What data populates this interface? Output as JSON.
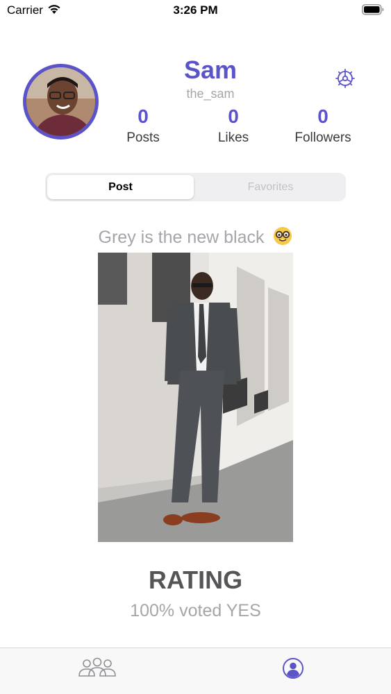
{
  "status_bar": {
    "carrier": "Carrier",
    "time": "3:26 PM"
  },
  "profile": {
    "name": "Sam",
    "handle": "the_sam",
    "stats": [
      {
        "value": "0",
        "label": "Posts"
      },
      {
        "value": "0",
        "label": "Likes"
      },
      {
        "value": "0",
        "label": "Followers"
      }
    ]
  },
  "segments": {
    "post_label": "Post",
    "favorites_label": "Favorites",
    "selected": "Post"
  },
  "post": {
    "caption": "Grey is the new black",
    "caption_emoji": "nerd-face-icon",
    "rating_title": "RATING",
    "rating_text": "100% voted YES"
  },
  "tab_bar": {
    "items": [
      {
        "icon": "people-icon",
        "active": false
      },
      {
        "icon": "profile-icon",
        "active": true
      }
    ]
  },
  "colors": {
    "accent": "#5b54c9",
    "secondary_text": "#a5a5aa",
    "inactive_icon": "#8e8e93"
  }
}
